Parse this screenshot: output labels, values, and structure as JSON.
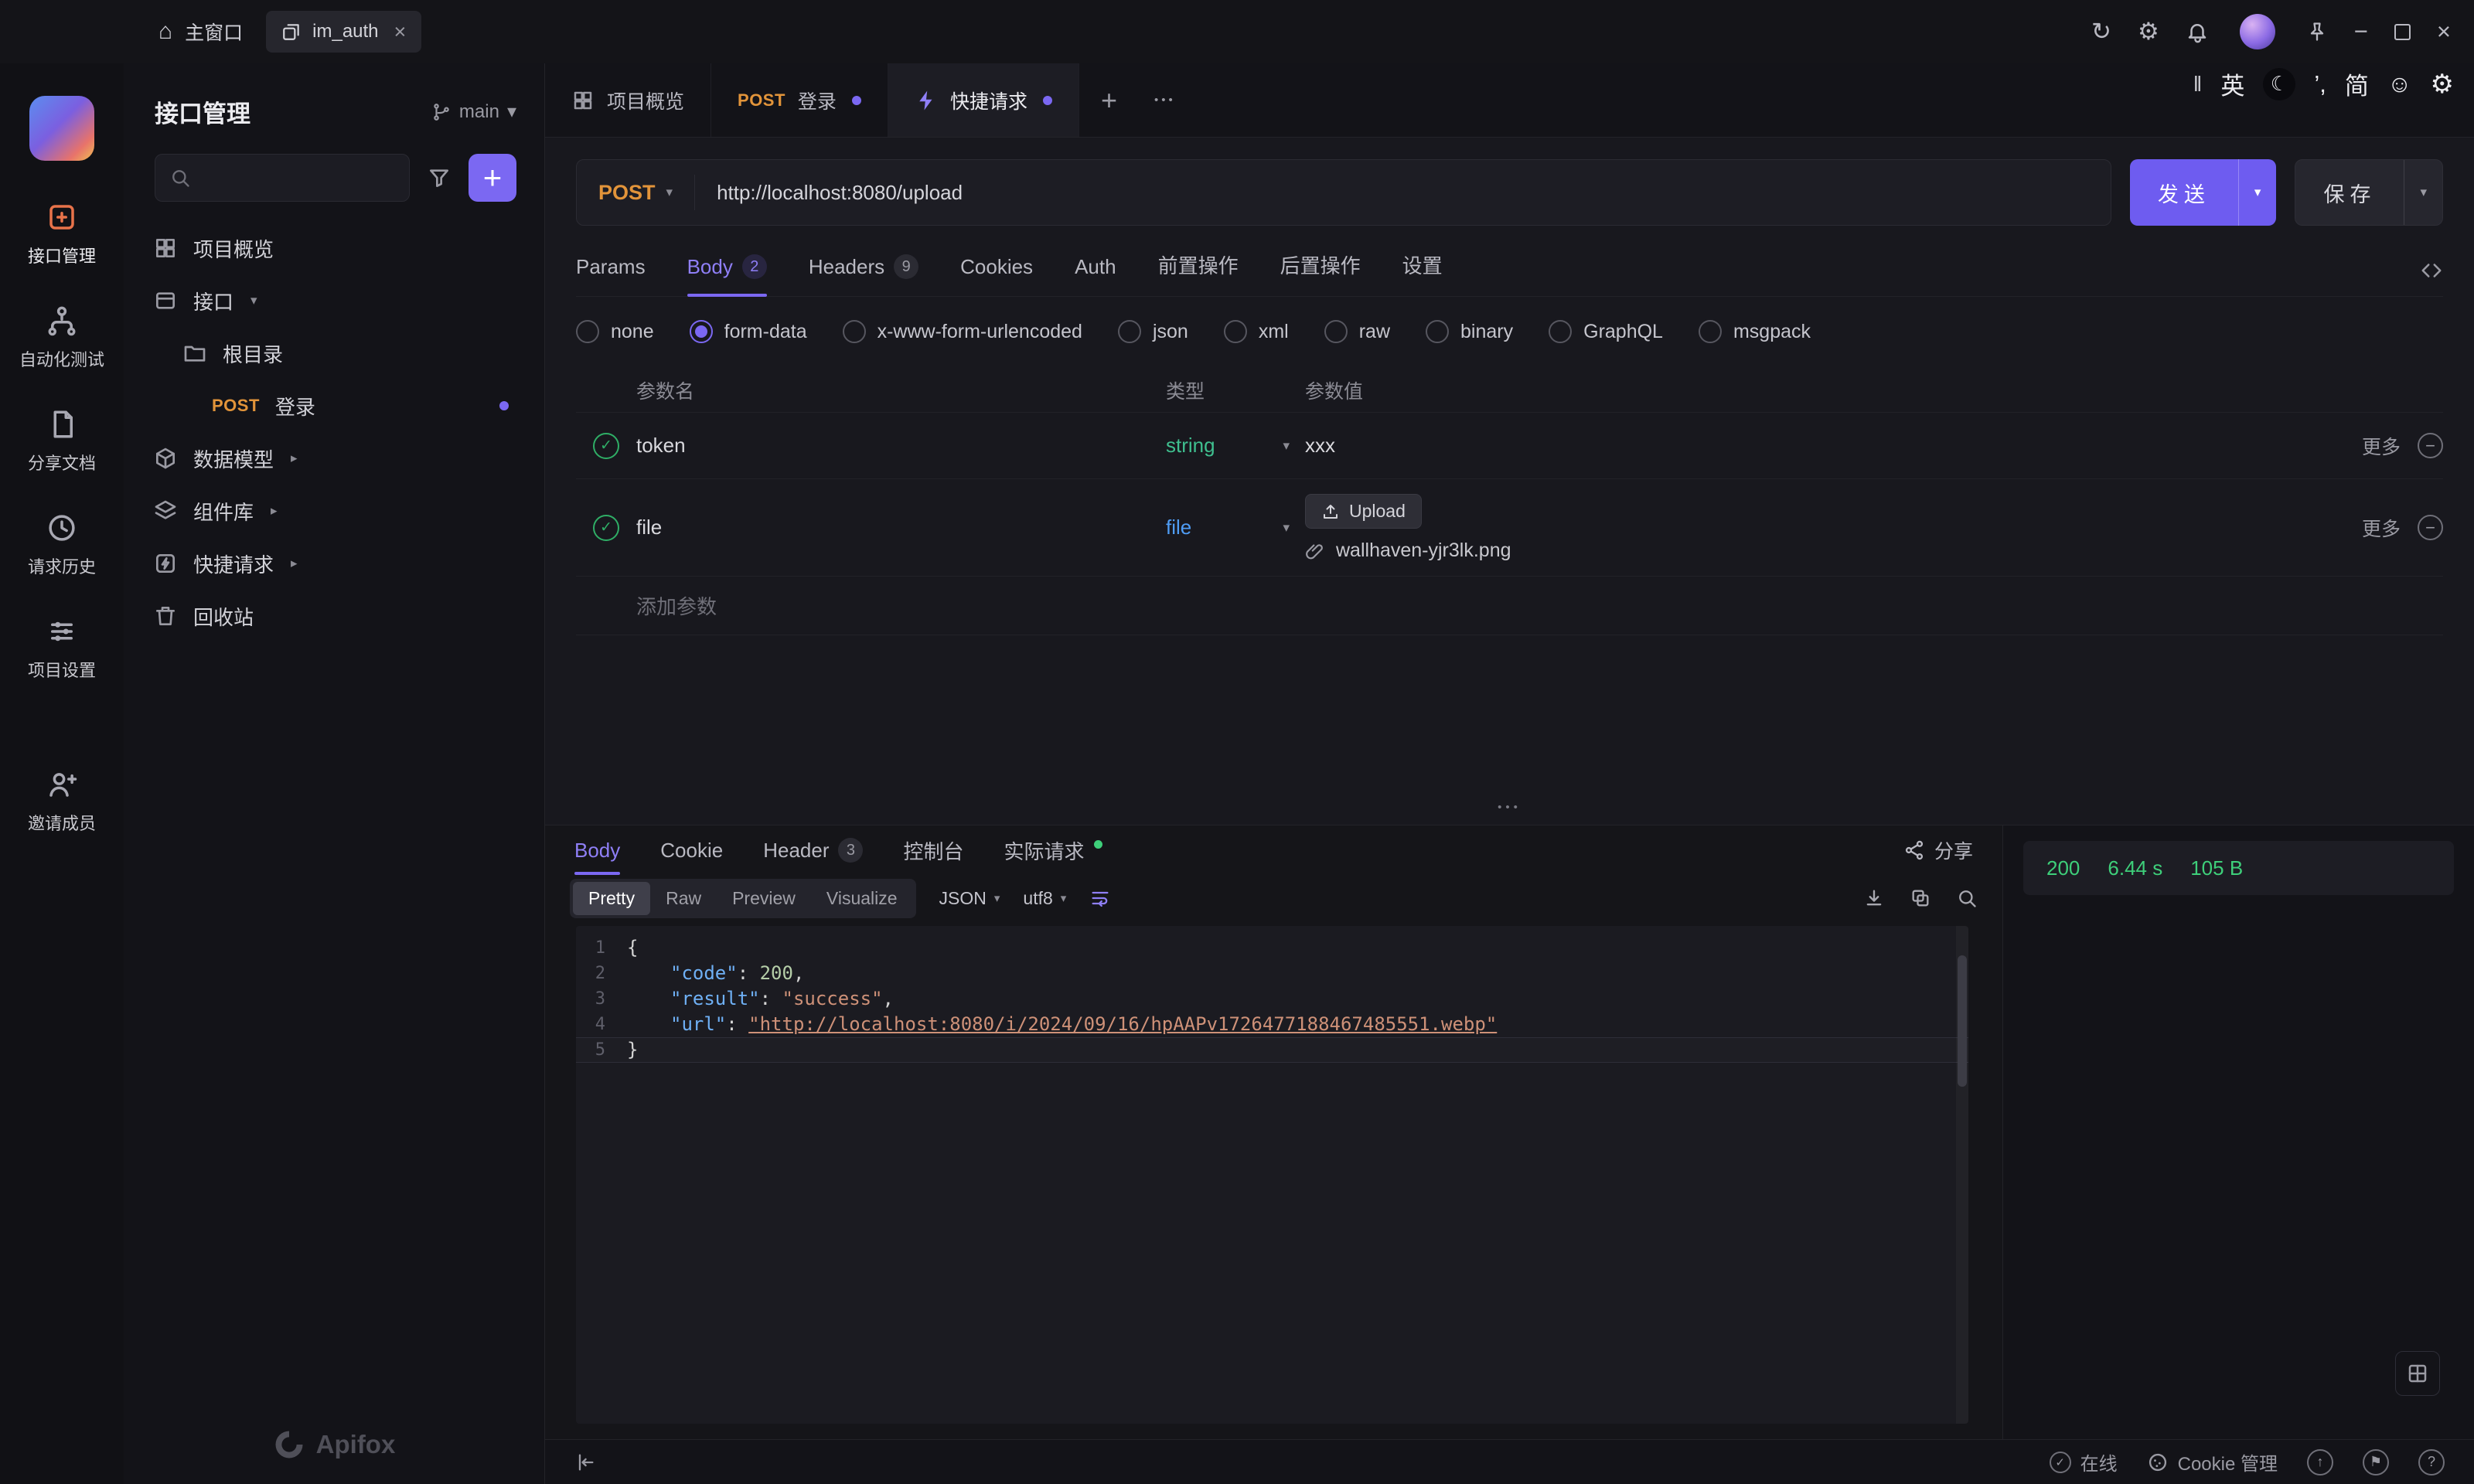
{
  "icons": {
    "home": "⌂",
    "close": "×",
    "refresh": "↻",
    "gear": "⚙",
    "minimize": "−",
    "moon": "☾",
    "smiley": "☺",
    "bars": "‖",
    "ime_punct": "’,",
    "caret_down": "▾",
    "caret_right": "▸",
    "plus": "+",
    "dots": "•••",
    "check": "✓",
    "minus": "−",
    "up_arrow": "↑",
    "flag": "⚑",
    "question": "?"
  },
  "titlebar": {
    "home_label": "主窗口",
    "tab_label": "im_auth"
  },
  "ime": {
    "lang": "英",
    "mode": "简"
  },
  "rail": {
    "items": [
      {
        "label": "接口管理"
      },
      {
        "label": "自动化测试"
      },
      {
        "label": "分享文档"
      },
      {
        "label": "请求历史"
      },
      {
        "label": "项目设置"
      },
      {
        "label": "邀请成员"
      }
    ]
  },
  "sidebar": {
    "title": "接口管理",
    "branch": "main",
    "items": [
      {
        "label": "项目概览"
      },
      {
        "label": "接口"
      },
      {
        "label": "根目录"
      },
      {
        "method": "POST",
        "label": "登录"
      },
      {
        "label": "数据模型"
      },
      {
        "label": "组件库"
      },
      {
        "label": "快捷请求"
      },
      {
        "label": "回收站"
      }
    ],
    "footer": "Apifox"
  },
  "tabs": {
    "items": [
      {
        "label": "项目概览"
      },
      {
        "method": "POST",
        "label": "登录"
      },
      {
        "label": "快捷请求"
      }
    ]
  },
  "request": {
    "method": "POST",
    "url": "http://localhost:8080/upload",
    "send_label": "发送",
    "save_label": "保存"
  },
  "req_tabs": {
    "items": [
      {
        "label": "Params"
      },
      {
        "label": "Body",
        "badge": "2"
      },
      {
        "label": "Headers",
        "badge": "9"
      },
      {
        "label": "Cookies"
      },
      {
        "label": "Auth"
      },
      {
        "label": "前置操作"
      },
      {
        "label": "后置操作"
      },
      {
        "label": "设置"
      }
    ]
  },
  "body_types": {
    "items": [
      {
        "label": "none"
      },
      {
        "label": "form-data"
      },
      {
        "label": "x-www-form-urlencoded"
      },
      {
        "label": "json"
      },
      {
        "label": "xml"
      },
      {
        "label": "raw"
      },
      {
        "label": "binary"
      },
      {
        "label": "GraphQL"
      },
      {
        "label": "msgpack"
      }
    ]
  },
  "params": {
    "headers": {
      "name": "参数名",
      "type": "类型",
      "value": "参数值"
    },
    "rows": [
      {
        "name": "token",
        "type": "string",
        "value": "xxx",
        "more": "更多"
      },
      {
        "name": "file",
        "type": "file",
        "upload_label": "Upload",
        "file_name": "wallhaven-yjr3lk.png",
        "more": "更多"
      }
    ],
    "add_label": "添加参数"
  },
  "response": {
    "tabs": [
      {
        "label": "Body"
      },
      {
        "label": "Cookie"
      },
      {
        "label": "Header",
        "badge": "3"
      },
      {
        "label": "控制台"
      },
      {
        "label": "实际请求"
      }
    ],
    "share_label": "分享",
    "modes": [
      {
        "label": "Pretty"
      },
      {
        "label": "Raw"
      },
      {
        "label": "Preview"
      },
      {
        "label": "Visualize"
      }
    ],
    "format": "JSON",
    "encoding": "utf8",
    "status": {
      "code": "200",
      "time": "6.44 s",
      "size": "105 B"
    }
  },
  "code": {
    "line_numbers": [
      "1",
      "2",
      "3",
      "4",
      "5"
    ],
    "l1": "{",
    "l2_key": "\"code\"",
    "l2_sep": ": ",
    "l2_val": "200",
    "l2_comma": ",",
    "l3_key": "\"result\"",
    "l3_sep": ": ",
    "l3_val": "\"success\"",
    "l3_comma": ",",
    "l4_key": "\"url\"",
    "l4_sep": ": ",
    "l4_val": "\"http://localhost:8080/i/2024/09/16/hpAAPv1726477188467485551.webp\"",
    "l5": "}"
  },
  "statusbar": {
    "online": "在线",
    "cookie": "Cookie 管理"
  }
}
